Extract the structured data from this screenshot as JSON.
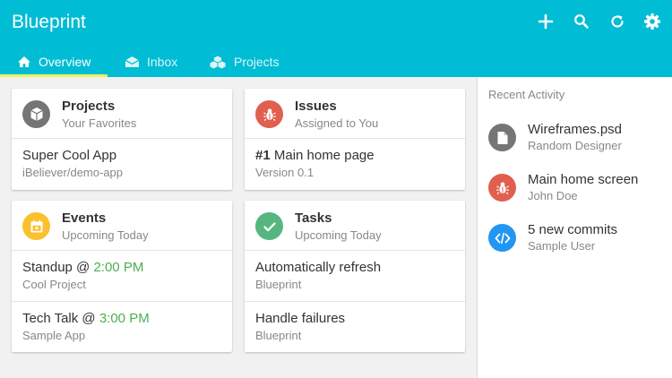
{
  "app": {
    "title": "Blueprint"
  },
  "toolbar": {
    "actions": [
      {
        "icon": "plus-icon"
      },
      {
        "icon": "search-icon"
      },
      {
        "icon": "refresh-icon"
      },
      {
        "icon": "gear-icon"
      }
    ]
  },
  "tabs": [
    {
      "label": "Overview",
      "icon": "home-icon",
      "active": true
    },
    {
      "label": "Inbox",
      "icon": "inbox-icon",
      "active": false
    },
    {
      "label": "Projects",
      "icon": "cubes-icon",
      "active": false
    }
  ],
  "colors": {
    "primary": "#00bcd4",
    "tab_indicator": "#e8f55e",
    "projects_avatar": "#757575",
    "issues_avatar": "#e05f4f",
    "events_avatar": "#fbc02d",
    "tasks_avatar": "#57b680",
    "commits_avatar": "#2196f3",
    "time_green": "#4caf50"
  },
  "cards": {
    "projects": {
      "title": "Projects",
      "subtitle": "Your Favorites",
      "icon": "cube-icon",
      "rows": [
        {
          "title": "Super Cool App",
          "subtitle": "iBeliever/demo-app"
        }
      ]
    },
    "issues": {
      "title": "Issues",
      "subtitle": "Assigned to You",
      "icon": "bug-icon",
      "rows": [
        {
          "number": "#1",
          "title": "Main home page",
          "subtitle": "Version 0.1"
        }
      ]
    },
    "events": {
      "title": "Events",
      "subtitle": "Upcoming Today",
      "icon": "calendar-icon",
      "rows": [
        {
          "title": "Standup @",
          "time": "2:00 PM",
          "subtitle": "Cool Project"
        },
        {
          "title": "Tech Talk @",
          "time": "3:00 PM",
          "subtitle": "Sample App"
        }
      ]
    },
    "tasks": {
      "title": "Tasks",
      "subtitle": "Upcoming Today",
      "icon": "check-icon",
      "rows": [
        {
          "title": "Automatically refresh",
          "subtitle": "Blueprint"
        },
        {
          "title": "Handle failures",
          "subtitle": "Blueprint"
        }
      ]
    }
  },
  "recent_activity": {
    "heading": "Recent Activity",
    "items": [
      {
        "title": "Wireframes.psd",
        "subtitle": "Random Designer",
        "icon": "file-icon"
      },
      {
        "title": "Main home screen",
        "subtitle": "John Doe",
        "icon": "bug-icon"
      },
      {
        "title": "5 new commits",
        "subtitle": "Sample User",
        "icon": "code-icon"
      }
    ]
  }
}
